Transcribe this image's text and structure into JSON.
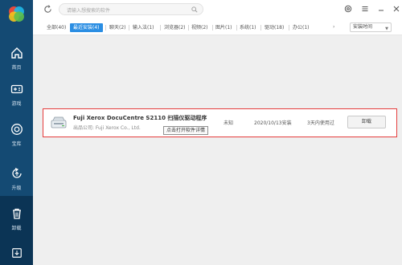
{
  "sidebar": {
    "items": [
      {
        "label": "首页",
        "icon": "home-icon"
      },
      {
        "label": "游戏",
        "icon": "gamepad-icon"
      },
      {
        "label": "宝库",
        "icon": "treasure-icon"
      },
      {
        "label": "升级",
        "icon": "upgrade-icon"
      },
      {
        "label": "卸载",
        "icon": "trash-icon",
        "active": true
      }
    ],
    "bottom_icon": "download-icon"
  },
  "search": {
    "placeholder": "请输入想搜索的软件"
  },
  "tabs": [
    {
      "label": "全部(40)"
    },
    {
      "label": "最近安装(4)",
      "active": true
    },
    {
      "label": "聊天(2)"
    },
    {
      "label": "输入法(1)"
    },
    {
      "label": "浏览器(2)"
    },
    {
      "label": "视频(2)"
    },
    {
      "label": "图片(1)"
    },
    {
      "label": "系统(1)"
    },
    {
      "label": "驱动(18)"
    },
    {
      "label": "办公(1)"
    }
  ],
  "tabs_more": "›",
  "sort": {
    "value": "安装时间"
  },
  "apps": [
    {
      "name": "Fuji Xerox DocuCentre S2110 扫描仪驱动程序",
      "publisher": "出品公司: Fuji Xerox Co., Ltd.",
      "size": "未知",
      "installed": "2020/10/13安装",
      "usage": "3天内使用过",
      "action": "卸载"
    }
  ],
  "tooltip": "点击打开软件详情",
  "colors": {
    "sidebar": "#144a73",
    "accent": "#2b8ee3",
    "highlight": "#e53c3c"
  }
}
